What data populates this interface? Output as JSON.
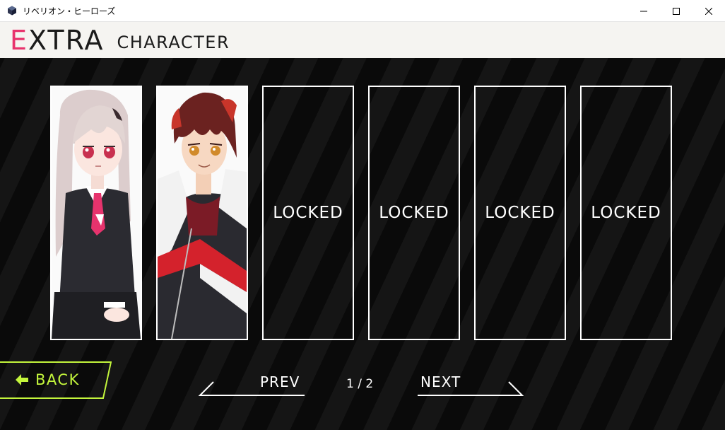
{
  "window": {
    "title": "リベリオン・ヒーローズ",
    "icon": "app-cube-icon",
    "controls": [
      "minimize-icon",
      "maximize-icon",
      "close-icon"
    ]
  },
  "header": {
    "title_first": "E",
    "title_rest": "XTRA",
    "subtitle": "CHARACTER",
    "accent_color": "#e8336d"
  },
  "characters": [
    {
      "status": "unlocked",
      "portrait": "girl-character-portrait"
    },
    {
      "status": "unlocked",
      "portrait": "boy-character-portrait"
    },
    {
      "status": "locked",
      "label": "LOCKED"
    },
    {
      "status": "locked",
      "label": "LOCKED"
    },
    {
      "status": "locked",
      "label": "LOCKED"
    },
    {
      "status": "locked",
      "label": "LOCKED"
    }
  ],
  "back": {
    "label": "BACK",
    "icon": "arrow-left-icon",
    "color": "#c3f53c"
  },
  "pager": {
    "prev_label": "PREV",
    "next_label": "NEXT",
    "indicator": "1 / 2"
  }
}
